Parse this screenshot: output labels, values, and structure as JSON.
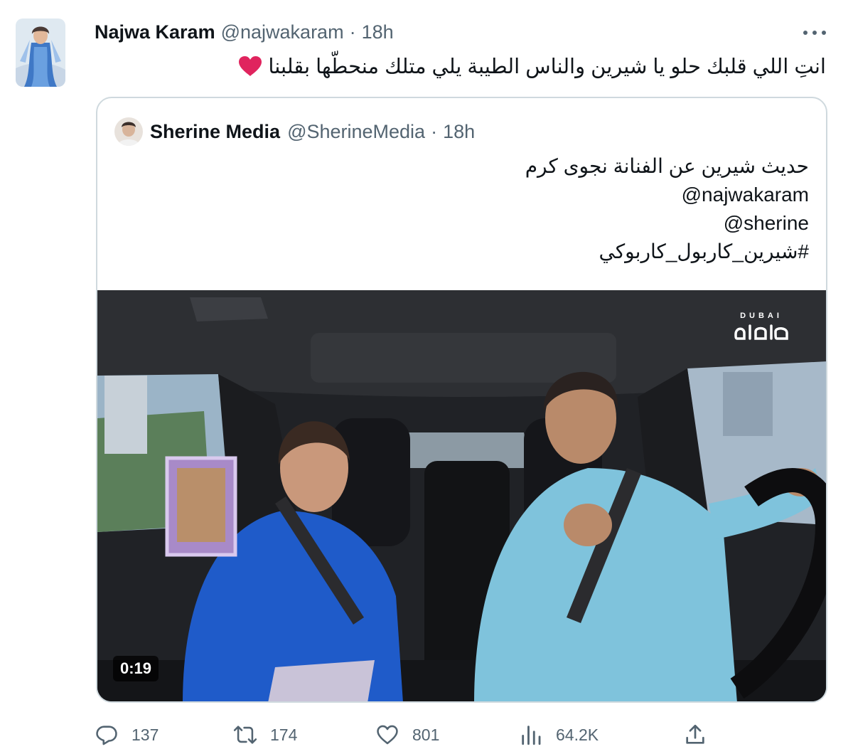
{
  "tweet": {
    "author_name": "Najwa Karam",
    "author_handle": "@najwakaram",
    "separator": "·",
    "time": "18h",
    "text": "انتِ اللي قلبك حلو يا شيرين والناس الطيبة يلي متلك منحطّها بقلبنا",
    "emoji": "red-heart",
    "colors": {
      "text": "#0f1419",
      "secondary": "#536471",
      "border": "#cfd9de",
      "heart": "#e0245e"
    }
  },
  "quoted_tweet": {
    "author_name": "Sherine Media",
    "author_handle": "@SherineMedia",
    "separator": "·",
    "time": "18h",
    "lines": [
      "حديث شيرين عن الفنانة نجوى كرم",
      "@najwakaram",
      "@sherine",
      "#شيرين_كاربول_كاربوكي"
    ],
    "video": {
      "duration": "0:19",
      "brand_small": "DUBAI",
      "brand_icon": "dubai-tv-logo"
    }
  },
  "actions": {
    "replies": "137",
    "retweets": "174",
    "likes": "801",
    "views": "64.2K",
    "icons": [
      "reply-icon",
      "retweet-icon",
      "like-icon",
      "views-icon",
      "share-icon"
    ]
  }
}
